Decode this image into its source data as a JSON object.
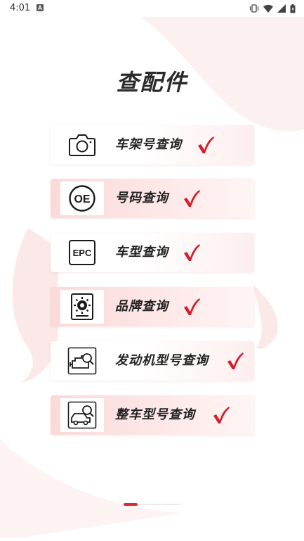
{
  "status_bar": {
    "time": "4:01",
    "icons": [
      "notification-a-icon",
      "vibrate-icon",
      "wifi-icon",
      "signal-icon",
      "battery-icon"
    ]
  },
  "page": {
    "title": "查配件"
  },
  "menu": {
    "items": [
      {
        "label": "车架号查询",
        "icon": "camera-icon"
      },
      {
        "label": "号码查询",
        "icon": "oe-icon"
      },
      {
        "label": "车型查询",
        "icon": "epc-icon"
      },
      {
        "label": "品牌查询",
        "icon": "brand-badge-icon"
      },
      {
        "label": "发动机型号查询",
        "icon": "engine-search-icon"
      },
      {
        "label": "整车型号查询",
        "icon": "car-search-icon"
      }
    ],
    "oe_text": "OE",
    "epc_text": "EPC"
  },
  "pager": {
    "active_index": 0
  },
  "colors": {
    "accent": "#e02a2a",
    "check": "#d41f2b",
    "text": "#222222"
  }
}
